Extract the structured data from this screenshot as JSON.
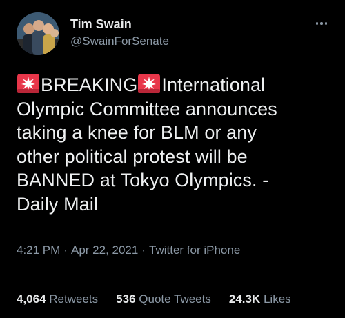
{
  "user": {
    "display_name": "Tim Swain",
    "handle": "@SwainForSenate"
  },
  "icons": {
    "more": "more-options-icon",
    "siren": "police-car-light-emoji"
  },
  "tweet": {
    "line_segments": [
      "BREAKING",
      "International",
      "Olympic Committee announces",
      "taking a knee for BLM or any",
      "other political protest will be",
      "BANNED at Tokyo Olympics. -",
      "Daily Mail"
    ]
  },
  "meta": {
    "time": "4:21 PM",
    "separator": "·",
    "date": "Apr 22, 2021",
    "client": "Twitter for iPhone"
  },
  "stats": {
    "retweets_count": "4,064",
    "retweets_label": "Retweets",
    "quotes_count": "536",
    "quotes_label": "Quote Tweets",
    "likes_count": "24.3K",
    "likes_label": "Likes"
  },
  "colors": {
    "background": "#000000",
    "primary_text": "#e7e9ea",
    "secondary_text": "#8b98a5",
    "divider": "#2f3336",
    "siren_red": "#e8364a"
  }
}
